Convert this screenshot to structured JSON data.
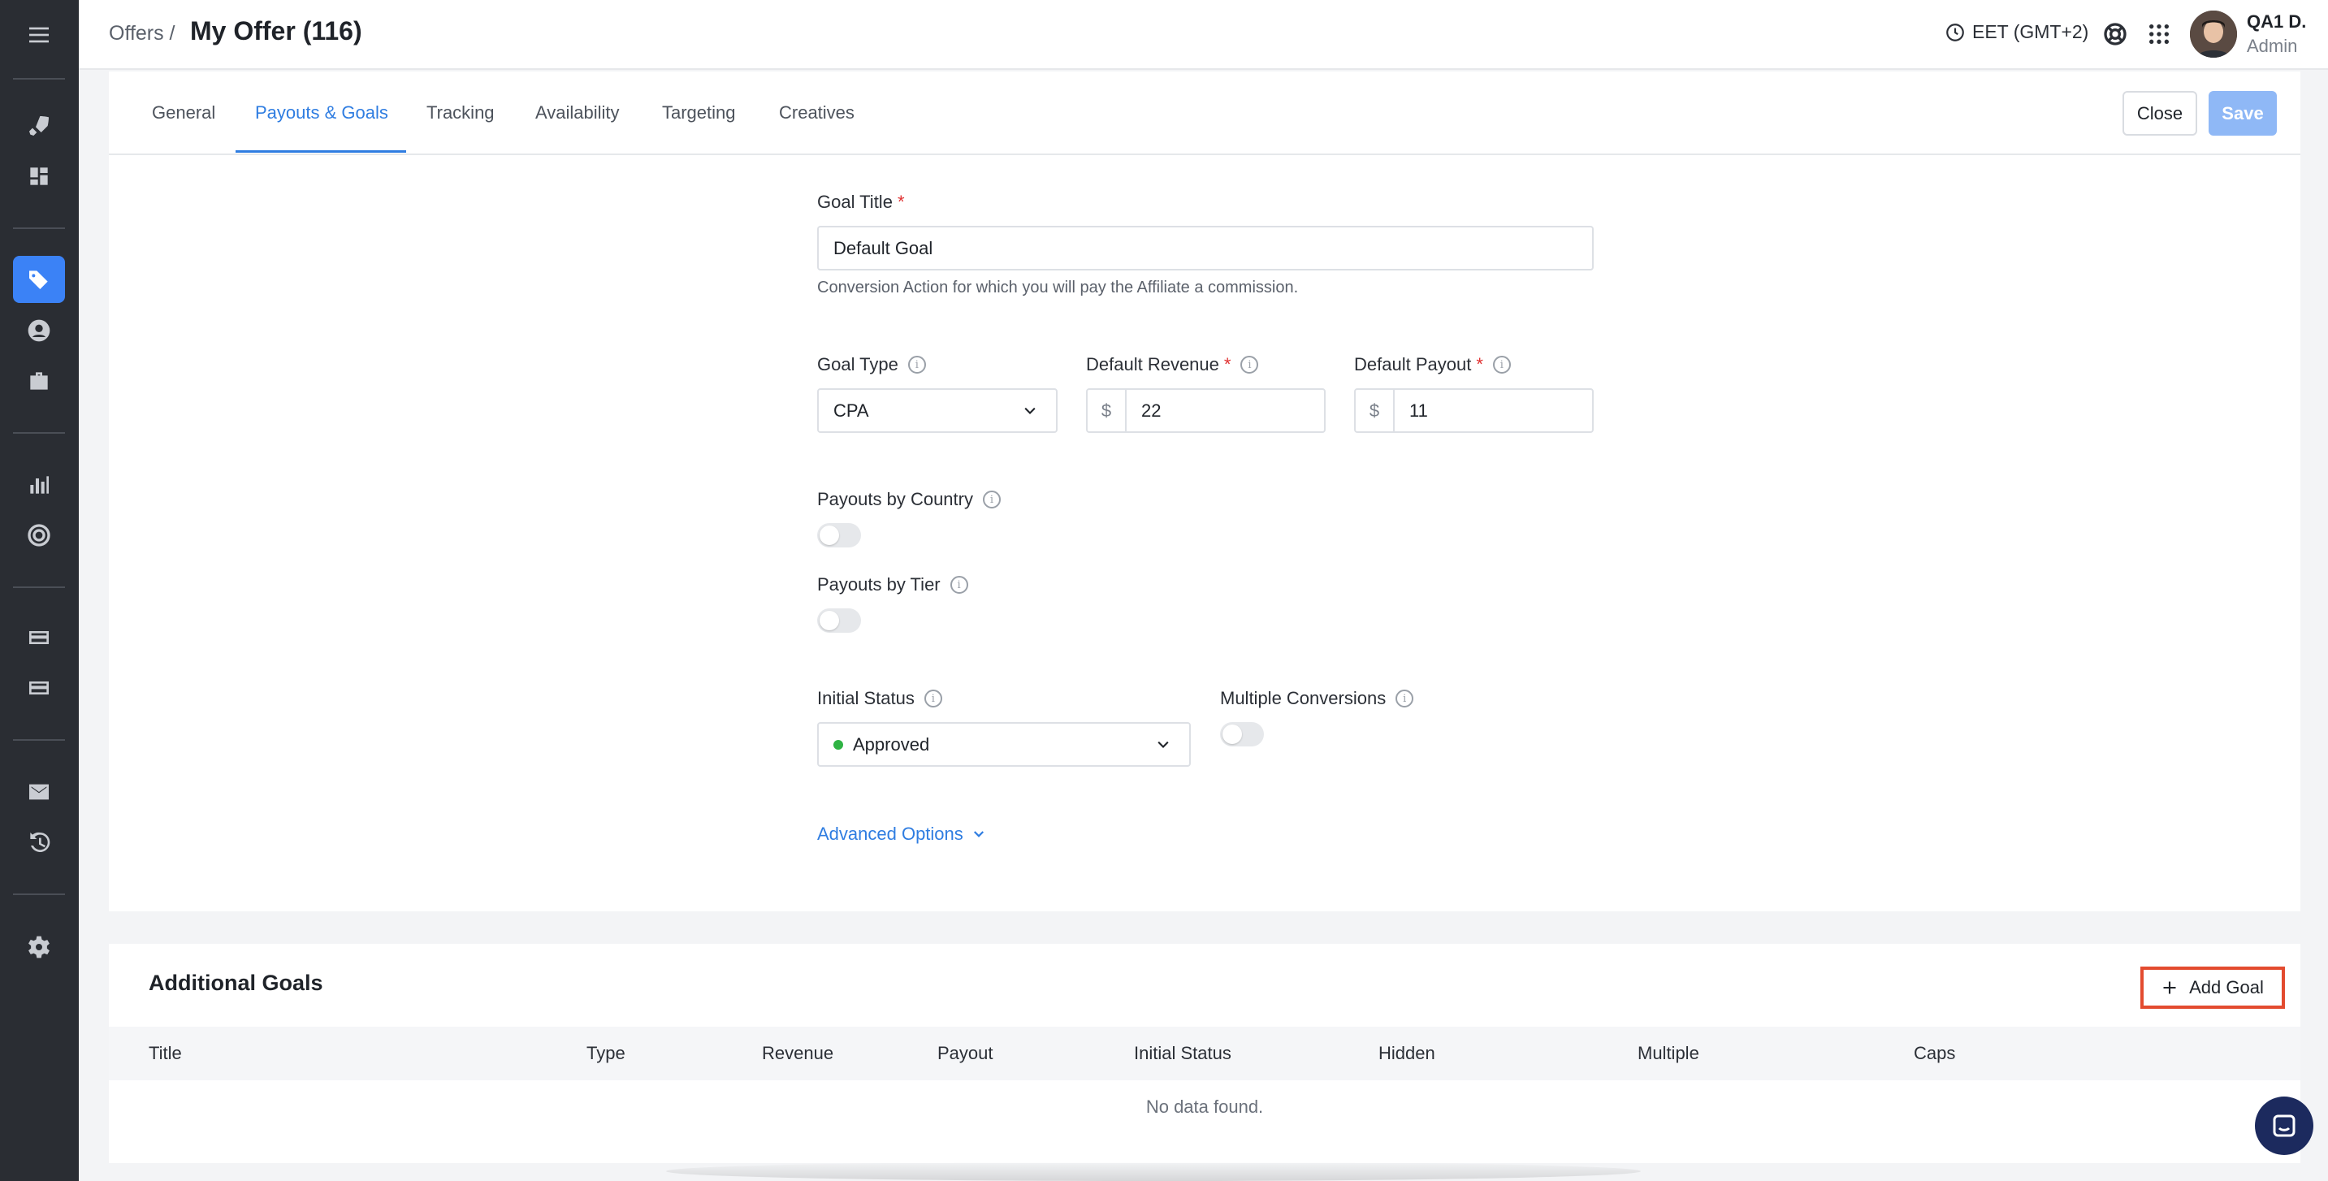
{
  "header": {
    "breadcrumb": "Offers /",
    "title": "My Offer (116)",
    "timezone": "EET (GMT+2)",
    "user_name": "QA1 D.",
    "user_role": "Admin"
  },
  "tabs": [
    "General",
    "Payouts & Goals",
    "Tracking",
    "Availability",
    "Targeting",
    "Creatives"
  ],
  "actions": {
    "close": "Close",
    "save": "Save"
  },
  "form": {
    "goal_title_label": "Goal Title",
    "goal_title_value": "Default Goal",
    "goal_title_help": "Conversion Action for which you will pay the Affiliate a commission.",
    "goal_type_label": "Goal Type",
    "goal_type_value": "CPA",
    "default_revenue_label": "Default Revenue",
    "default_revenue_currency": "$",
    "default_revenue_value": "22",
    "default_payout_label": "Default Payout",
    "default_payout_currency": "$",
    "default_payout_value": "11",
    "payouts_by_country_label": "Payouts by Country",
    "payouts_by_tier_label": "Payouts by Tier",
    "initial_status_label": "Initial Status",
    "initial_status_value": "Approved",
    "multiple_conversions_label": "Multiple Conversions",
    "advanced_options": "Advanced Options"
  },
  "additional_goals": {
    "title": "Additional Goals",
    "add_button": "Add Goal",
    "columns": [
      "Title",
      "Type",
      "Revenue",
      "Payout",
      "Initial Status",
      "Hidden",
      "Multiple",
      "Caps"
    ],
    "empty_text": "No data found."
  },
  "colors": {
    "accent": "#2f7de1",
    "sidebar": "#2a2d33",
    "status_approved": "#2fb344",
    "highlight": "#e34b2f"
  }
}
